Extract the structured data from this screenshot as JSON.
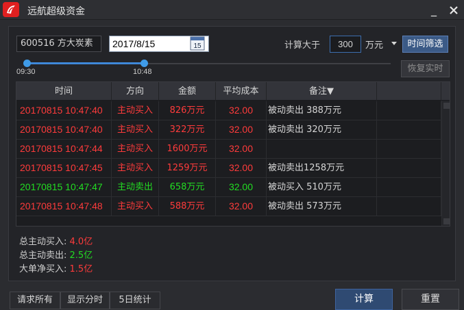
{
  "window": {
    "title": "远航超级资金",
    "minimize_glyph": "_",
    "icons": [
      "app-logo-icon",
      "close-icon"
    ]
  },
  "toolbar": {
    "stock": "600516 方大炭素",
    "date": "2017/8/15",
    "calendar_day": "15",
    "calc_label": "计算大于",
    "amount": "300",
    "unit": "万元",
    "filter_button": "时间筛选",
    "restore_button": "恢复实时"
  },
  "slider": {
    "start_label": "09:30",
    "end_label": "10:48",
    "start_fraction": 0.0,
    "end_fraction": 0.32
  },
  "table": {
    "headers": [
      "时间",
      "方向",
      "金额",
      "平均成本",
      "备注▼"
    ],
    "rows": [
      {
        "time": "20170815 10:47:40",
        "dir": "主动买入",
        "amount": "826万元",
        "cost": "32.00",
        "note": "被动卖出 388万元",
        "color": "#ff3b3b"
      },
      {
        "time": "20170815 10:47:40",
        "dir": "主动买入",
        "amount": "322万元",
        "cost": "32.00",
        "note": "被动卖出 320万元",
        "color": "#ff3b3b"
      },
      {
        "time": "20170815 10:47:44",
        "dir": "主动买入",
        "amount": "1600万元",
        "cost": "32.00",
        "note": "",
        "color": "#ff3b3b"
      },
      {
        "time": "20170815 10:47:45",
        "dir": "主动买入",
        "amount": "1259万元",
        "cost": "32.00",
        "note": "被动卖出1258万元",
        "color": "#ff3b3b"
      },
      {
        "time": "20170815 10:47:47",
        "dir": "主动卖出",
        "amount": "658万元",
        "cost": "32.00",
        "note": "被动买入 510万元",
        "color": "#22dd22"
      },
      {
        "time": "20170815 10:47:48",
        "dir": "主动买入",
        "amount": "588万元",
        "cost": "32.00",
        "note": "被动卖出 573万元",
        "color": "#ff3b3b"
      }
    ]
  },
  "summary": [
    {
      "label": "总主动买入: ",
      "value": "4.0亿",
      "color": "#ff3b3b"
    },
    {
      "label": "总主动卖出: ",
      "value": "2.5亿",
      "color": "#22dd22"
    },
    {
      "label": "大单净买入: ",
      "value": "1.5亿",
      "color": "#ff3b3b"
    }
  ],
  "bottom": {
    "request_all": "请求所有",
    "show_minute": "显示分时",
    "five_day": "5日统计",
    "calc": "计算",
    "reset": "重置"
  }
}
